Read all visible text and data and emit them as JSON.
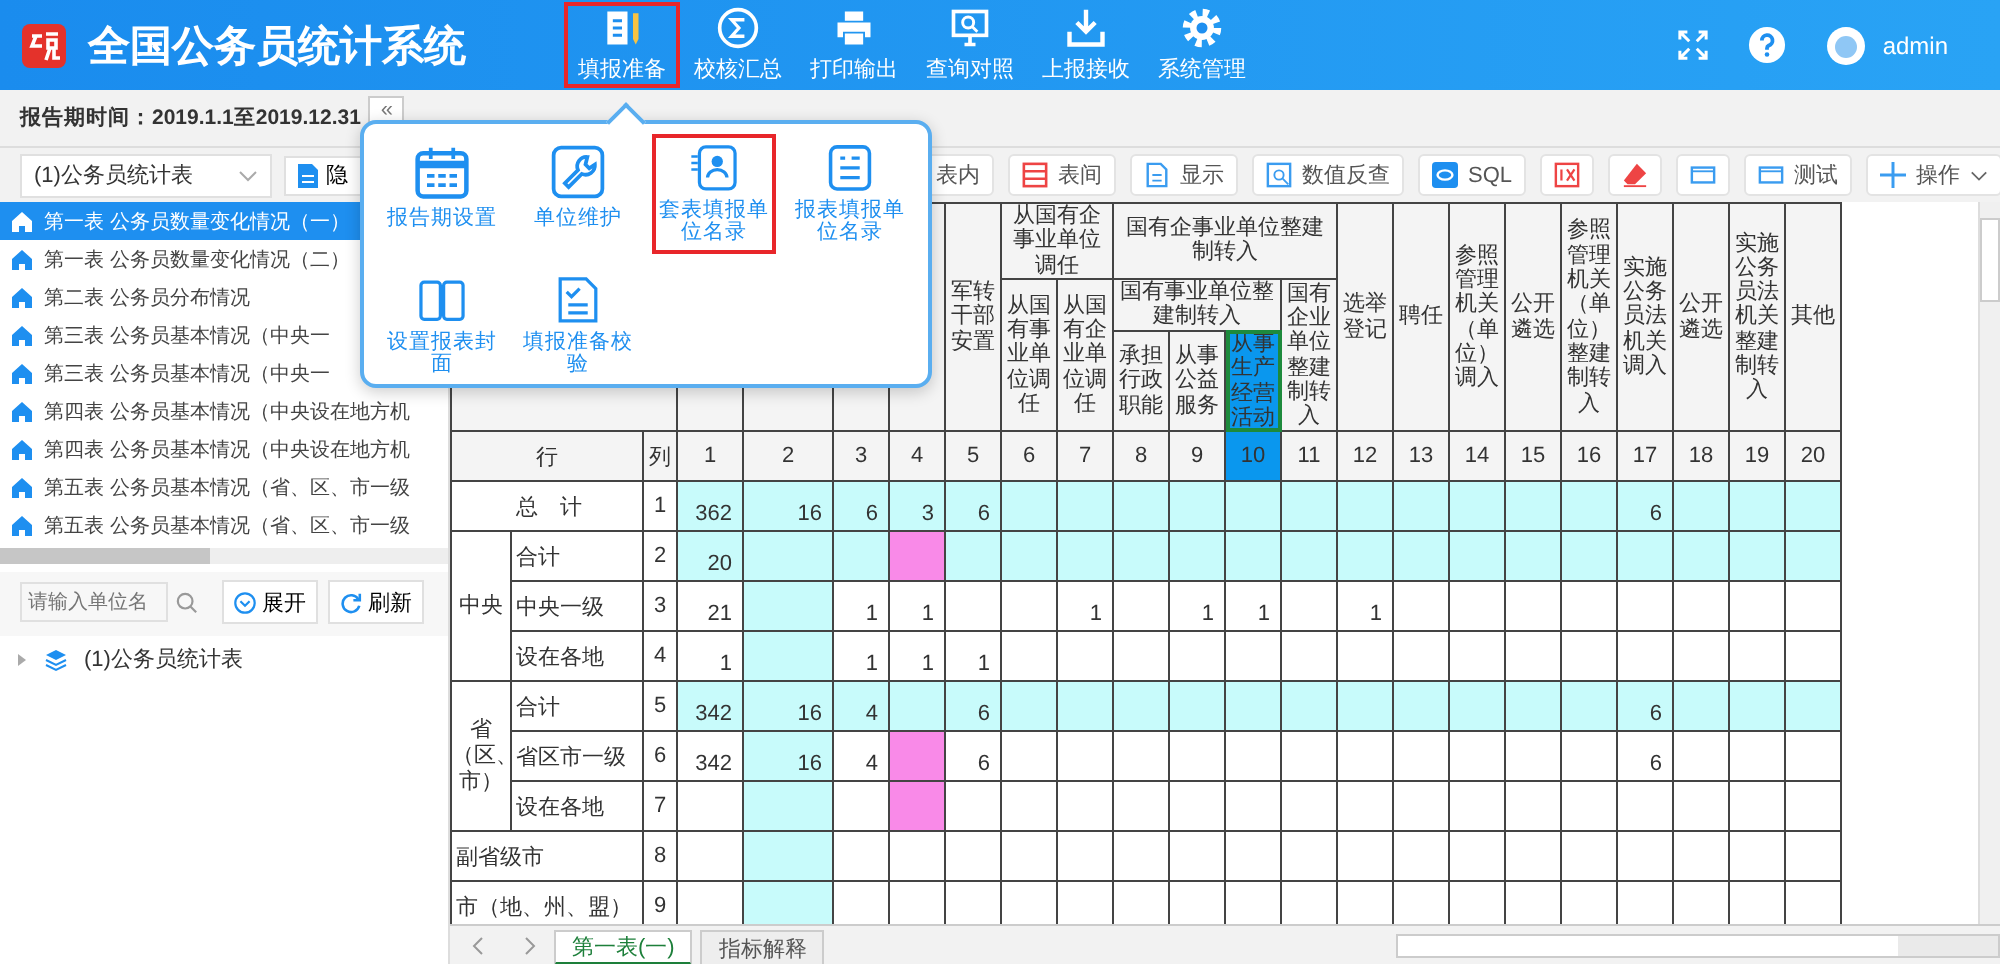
{
  "app": {
    "title": "全国公务员统计系统",
    "user": "admin"
  },
  "nav": [
    {
      "label": "填报准备",
      "kind": "form",
      "selected": true
    },
    {
      "label": "校核汇总",
      "kind": "sum",
      "selected": false
    },
    {
      "label": "打印输出",
      "kind": "print",
      "selected": false
    },
    {
      "label": "查询对照",
      "kind": "query",
      "selected": false
    },
    {
      "label": "上报接收",
      "kind": "upload",
      "selected": false
    },
    {
      "label": "系统管理",
      "kind": "settings",
      "selected": false
    }
  ],
  "report_period": "报告期时间：2019.1.1至2019.12.31",
  "collapse_button": "«",
  "prepare_menu": [
    {
      "label": "报告期设置",
      "kind": "calendar",
      "selected": false
    },
    {
      "label": "单位维护",
      "kind": "wrench",
      "selected": false
    },
    {
      "label": "套表填报单位名录",
      "kind": "card",
      "selected": true
    },
    {
      "label": "报表填报单位名录",
      "kind": "list",
      "selected": false
    },
    {
      "label": "设置报表封面",
      "kind": "book",
      "selected": false
    },
    {
      "label": "填报准备校验",
      "kind": "check",
      "selected": false
    }
  ],
  "table_picker": {
    "value": "(1)公务员统计表"
  },
  "hide_button": "隐",
  "table_list": [
    {
      "label": "第一表 公务员数量变化情况（一）",
      "selected": true
    },
    {
      "label": "第一表 公务员数量变化情况（二）",
      "selected": false
    },
    {
      "label": "第二表 公务员分布情况",
      "selected": false
    },
    {
      "label": "第三表 公务员基本情况（中央一",
      "selected": false
    },
    {
      "label": "第三表 公务员基本情况（中央一",
      "selected": false
    },
    {
      "label": "第四表 公务员基本情况（中央设在地方机",
      "selected": false
    },
    {
      "label": "第四表 公务员基本情况（中央设在地方机",
      "selected": false
    },
    {
      "label": "第五表 公务员基本情况（省、区、市一级",
      "selected": false
    },
    {
      "label": "第五表 公务员基本情况（省、区、市一级",
      "selected": false
    }
  ],
  "unit_search": {
    "placeholder": "请输入单位名"
  },
  "expand_button": "展开",
  "refresh_button": "刷新",
  "unit_tree": [
    {
      "label": "(1)公务员统计表",
      "expanded": false
    }
  ],
  "toolbar": [
    {
      "label": "表内",
      "kind": "plain"
    },
    {
      "label": "表间",
      "kind": "table"
    },
    {
      "label": "显示",
      "kind": "doc"
    },
    {
      "label": "数值反查",
      "kind": "lookup"
    },
    {
      "label": "SQL",
      "kind": "sql"
    },
    {
      "kind": "mark"
    },
    {
      "kind": "eraser"
    },
    {
      "kind": "window"
    },
    {
      "label": "测试",
      "kind": "window"
    }
  ],
  "operate_button": "操作",
  "sheet": {
    "corner_row": "行",
    "corner_col": "列",
    "header": [
      {
        "label": "军转干部安置"
      },
      {
        "label": "从国有企事业单位调任",
        "children": [
          {
            "label": "从国有事业单位调任"
          },
          {
            "label": "从国有企业单位调任"
          }
        ]
      },
      {
        "label": "国有企事业单位整建制转入",
        "children": [
          {
            "label": "国有事业单位整建制转入",
            "children": [
              {
                "label": "承担行政职能"
              },
              {
                "label": "从事公益服务"
              },
              {
                "label": "从事生产经营活动"
              }
            ]
          },
          {
            "label": "国有企业单位整建制转入"
          }
        ]
      },
      {
        "label": "选举登记"
      },
      {
        "label": "聘任"
      },
      {
        "label": "参照管理机关（单位）调入"
      },
      {
        "label": "公开遴选"
      },
      {
        "label": "参照管理机关（单位）整建制转入"
      },
      {
        "label": "实施公务员法机关调入"
      },
      {
        "label": "公开遴选"
      },
      {
        "label": "实施公务员法机关整建制转入"
      },
      {
        "label": "其他"
      }
    ],
    "columns": [
      {
        "label": "1",
        "highlighted": false,
        "selected": false
      },
      {
        "label": "2",
        "highlighted": true,
        "selected": false
      },
      {
        "label": "3",
        "highlighted": false,
        "selected": false
      },
      {
        "label": "4",
        "highlighted": false,
        "selected": false
      },
      {
        "label": "5",
        "highlighted": false,
        "selected": false
      },
      {
        "label": "6",
        "highlighted": false,
        "selected": false
      },
      {
        "label": "7",
        "highlighted": false,
        "selected": false
      },
      {
        "label": "8",
        "highlighted": false,
        "selected": false
      },
      {
        "label": "9",
        "highlighted": false,
        "selected": false
      },
      {
        "label": "10",
        "highlighted": false,
        "selected": true
      },
      {
        "label": "11",
        "highlighted": false,
        "selected": false
      },
      {
        "label": "12",
        "highlighted": false,
        "selected": false
      },
      {
        "label": "13",
        "highlighted": false,
        "selected": false
      },
      {
        "label": "14",
        "highlighted": false,
        "selected": false
      },
      {
        "label": "15",
        "highlighted": false,
        "selected": false
      },
      {
        "label": "16",
        "highlighted": false,
        "selected": false
      },
      {
        "label": "17",
        "highlighted": false,
        "selected": false
      },
      {
        "label": "18",
        "highlighted": false,
        "selected": false
      },
      {
        "label": "19",
        "highlighted": false,
        "selected": false
      },
      {
        "label": "20",
        "highlighted": false,
        "selected": false
      }
    ],
    "rows": [
      {
        "label": "总　计",
        "number": "1",
        "highlighted": true,
        "cells": [
          {
            "value": "362",
            "flagged": false
          },
          {
            "value": "16",
            "flagged": false
          },
          {
            "value": "6",
            "flagged": false
          },
          {
            "value": "3",
            "flagged": false
          },
          {
            "value": "6",
            "flagged": false
          },
          null,
          null,
          null,
          null,
          null,
          null,
          null,
          null,
          null,
          null,
          null,
          {
            "value": "6",
            "flagged": false
          },
          null,
          null,
          null
        ]
      },
      {
        "label": "中央",
        "rows": [
          {
            "label": "合计",
            "number": "2",
            "highlighted": true,
            "cells": [
              {
                "value": "20",
                "flagged": false
              },
              null,
              null,
              {
                "flagged": true
              },
              null,
              null,
              null,
              null,
              null,
              null,
              null,
              null,
              null,
              null,
              null,
              null,
              null,
              null,
              null,
              null
            ]
          },
          {
            "label": "中央一级",
            "number": "3",
            "highlighted": false,
            "cells": [
              {
                "value": "21",
                "flagged": false
              },
              null,
              {
                "value": "1",
                "flagged": false
              },
              {
                "value": "1",
                "flagged": false
              },
              null,
              null,
              {
                "value": "1",
                "flagged": false
              },
              null,
              {
                "value": "1",
                "flagged": false
              },
              {
                "value": "1",
                "flagged": false
              },
              null,
              {
                "value": "1",
                "flagged": false
              },
              null,
              null,
              null,
              null,
              null,
              null,
              null,
              null
            ]
          },
          {
            "label": "设在各地",
            "number": "4",
            "highlighted": false,
            "cells": [
              {
                "value": "1",
                "flagged": false
              },
              null,
              {
                "value": "1",
                "flagged": false
              },
              {
                "value": "1",
                "flagged": false
              },
              {
                "value": "1",
                "flagged": false
              },
              null,
              null,
              null,
              null,
              null,
              null,
              null,
              null,
              null,
              null,
              null,
              null,
              null,
              null,
              null
            ]
          }
        ]
      },
      {
        "label": "省（区、市）",
        "rows": [
          {
            "label": "合计",
            "number": "5",
            "highlighted": true,
            "cells": [
              {
                "value": "342",
                "flagged": false
              },
              {
                "value": "16",
                "flagged": false
              },
              {
                "value": "4",
                "flagged": false
              },
              null,
              {
                "value": "6",
                "flagged": false
              },
              null,
              null,
              null,
              null,
              null,
              null,
              null,
              null,
              null,
              null,
              null,
              {
                "value": "6",
                "flagged": false
              },
              null,
              null,
              null
            ]
          },
          {
            "label": "省区市一级",
            "number": "6",
            "highlighted": false,
            "cells": [
              {
                "value": "342",
                "flagged": false
              },
              {
                "value": "16",
                "flagged": false
              },
              {
                "value": "4",
                "flagged": false
              },
              {
                "flagged": true
              },
              {
                "value": "6",
                "flagged": false
              },
              null,
              null,
              null,
              null,
              null,
              null,
              null,
              null,
              null,
              null,
              null,
              {
                "value": "6",
                "flagged": false
              },
              null,
              null,
              null
            ]
          },
          {
            "label": "设在各地",
            "number": "7",
            "highlighted": false,
            "cells": [
              null,
              null,
              null,
              {
                "flagged": true
              },
              null,
              null,
              null,
              null,
              null,
              null,
              null,
              null,
              null,
              null,
              null,
              null,
              null,
              null,
              null,
              null
            ]
          }
        ]
      },
      {
        "label": "副省级市",
        "number": "8",
        "highlighted": false,
        "cells": [
          null,
          null,
          null,
          null,
          null,
          null,
          null,
          null,
          null,
          null,
          null,
          null,
          null,
          null,
          null,
          null,
          null,
          null,
          null,
          null
        ]
      },
      {
        "label": "市（地、州、盟）",
        "number": "9",
        "highlighted": false,
        "cells": [
          null,
          null,
          null,
          null,
          null,
          null,
          null,
          null,
          null,
          null,
          null,
          null,
          null,
          null,
          null,
          null,
          null,
          null,
          null,
          null
        ]
      }
    ]
  },
  "sheet_tabs": [
    {
      "label": "第一表(一)",
      "selected": true
    },
    {
      "label": "指标解释",
      "selected": false
    }
  ]
}
